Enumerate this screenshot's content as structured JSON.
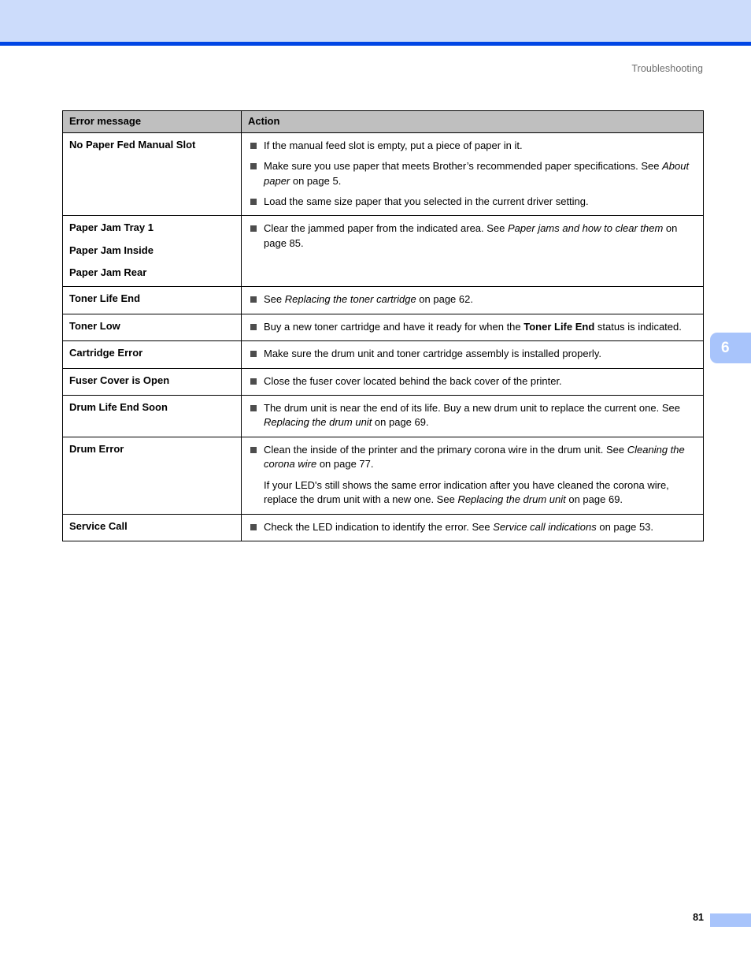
{
  "header": {
    "running_head": "Troubleshooting"
  },
  "chapter_tab": {
    "number": "6",
    "color": "#a8c4fb"
  },
  "footer": {
    "page_number": "81",
    "block_color": "#a8c4fb"
  },
  "theme": {
    "header_band": "#ccdcfb",
    "header_rule": "#0046e5",
    "table_header_bg": "#bfbfbf",
    "bullet": "#4d4d4d",
    "running_head_text": "#6d6d6d"
  },
  "table": {
    "columns": [
      "Error message",
      "Action"
    ],
    "rows": [
      {
        "messages": [
          "No Paper Fed Manual Slot"
        ],
        "actions": [
          {
            "bullet": true,
            "parts": [
              {
                "text": "If the manual feed slot is empty, put a piece of paper in it.",
                "style": "normal"
              }
            ]
          },
          {
            "bullet": true,
            "parts": [
              {
                "text": "Make sure you use paper that meets Brother’s recommended paper specifications. See ",
                "style": "normal"
              },
              {
                "text": "About paper",
                "style": "italic"
              },
              {
                "text": " on page 5.",
                "style": "normal"
              }
            ]
          },
          {
            "bullet": true,
            "parts": [
              {
                "text": "Load the same size paper that you selected in the current driver setting.",
                "style": "normal"
              }
            ]
          }
        ]
      },
      {
        "messages": [
          "Paper Jam Tray 1",
          "Paper Jam Inside",
          "Paper Jam Rear"
        ],
        "actions": [
          {
            "bullet": true,
            "parts": [
              {
                "text": "Clear the jammed paper from the indicated area. See ",
                "style": "normal"
              },
              {
                "text": "Paper jams and how to clear them",
                "style": "italic"
              },
              {
                "text": " on page 85.",
                "style": "normal"
              }
            ]
          }
        ]
      },
      {
        "messages": [
          "Toner Life End"
        ],
        "actions": [
          {
            "bullet": true,
            "parts": [
              {
                "text": "See ",
                "style": "normal"
              },
              {
                "text": "Replacing the toner cartridge",
                "style": "italic"
              },
              {
                "text": " on page 62.",
                "style": "normal"
              }
            ]
          }
        ]
      },
      {
        "messages": [
          "Toner Low"
        ],
        "actions": [
          {
            "bullet": true,
            "parts": [
              {
                "text": "Buy a new toner cartridge and have it ready for when the ",
                "style": "normal"
              },
              {
                "text": "Toner Life End",
                "style": "bold"
              },
              {
                "text": " status is indicated.",
                "style": "normal"
              }
            ]
          }
        ]
      },
      {
        "messages": [
          "Cartridge Error"
        ],
        "actions": [
          {
            "bullet": true,
            "parts": [
              {
                "text": "Make sure the drum unit and toner cartridge assembly is installed properly.",
                "style": "normal"
              }
            ]
          }
        ]
      },
      {
        "messages": [
          "Fuser Cover is Open"
        ],
        "actions": [
          {
            "bullet": true,
            "parts": [
              {
                "text": "Close the fuser cover located behind the back cover of the printer.",
                "style": "normal"
              }
            ]
          }
        ]
      },
      {
        "messages": [
          "Drum Life End Soon"
        ],
        "actions": [
          {
            "bullet": true,
            "parts": [
              {
                "text": "The drum unit is near the end of its life. Buy a new drum unit to replace the current one. See ",
                "style": "normal"
              },
              {
                "text": "Replacing the drum unit",
                "style": "italic"
              },
              {
                "text": " on page 69.",
                "style": "normal"
              }
            ]
          }
        ]
      },
      {
        "messages": [
          "Drum Error"
        ],
        "actions": [
          {
            "bullet": true,
            "parts": [
              {
                "text": "Clean the inside of the printer and the primary corona wire in the drum unit. See ",
                "style": "normal"
              },
              {
                "text": "Cleaning the corona wire",
                "style": "italic"
              },
              {
                "text": " on page 77.",
                "style": "normal"
              }
            ]
          },
          {
            "bullet": false,
            "parts": [
              {
                "text": "If your LED's still shows the same error indication after you have cleaned the corona wire, replace the drum unit with a new one. See ",
                "style": "normal"
              },
              {
                "text": "Replacing the drum unit",
                "style": "italic"
              },
              {
                "text": " on page 69.",
                "style": "normal"
              }
            ]
          }
        ]
      },
      {
        "messages": [
          "Service Call"
        ],
        "actions": [
          {
            "bullet": true,
            "parts": [
              {
                "text": "Check the LED indication to identify the error. See ",
                "style": "normal"
              },
              {
                "text": "Service call indications",
                "style": "italic"
              },
              {
                "text": " on page 53.",
                "style": "normal"
              }
            ]
          }
        ]
      }
    ]
  }
}
